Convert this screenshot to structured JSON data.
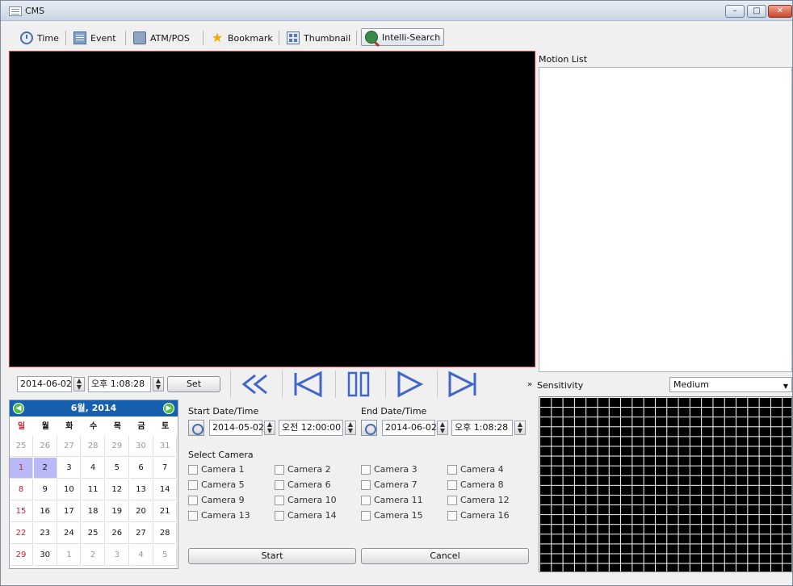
{
  "window": {
    "title": "CMS",
    "minimize": "–",
    "maximize": "□",
    "close": "✕"
  },
  "toolbar": {
    "items": [
      {
        "label": "Time",
        "icon": "clock-icon"
      },
      {
        "label": "Event",
        "icon": "event-icon"
      },
      {
        "label": "ATM/POS",
        "icon": "atm-pos-icon"
      },
      {
        "label": "Bookmark",
        "icon": "bookmark-star-icon"
      },
      {
        "label": "Thumbnail",
        "icon": "thumbnail-icon"
      },
      {
        "label": "Intelli-Search",
        "icon": "intelli-search-icon"
      }
    ]
  },
  "motion": {
    "label": "Motion List"
  },
  "playback": {
    "date": "2014-06-02",
    "time": "오후 1:08:28",
    "set": "Set",
    "more": "»"
  },
  "sensitivity": {
    "label": "Sensitivity",
    "value": "Medium"
  },
  "calendar": {
    "month_label": "6월, 2014",
    "weekdays": [
      "일",
      "월",
      "화",
      "수",
      "목",
      "금",
      "토"
    ],
    "weeks": [
      [
        "25",
        "26",
        "27",
        "28",
        "29",
        "30",
        "31"
      ],
      [
        "1",
        "2",
        "3",
        "4",
        "5",
        "6",
        "7"
      ],
      [
        "8",
        "9",
        "10",
        "11",
        "12",
        "13",
        "14"
      ],
      [
        "15",
        "16",
        "17",
        "18",
        "19",
        "20",
        "21"
      ],
      [
        "22",
        "23",
        "24",
        "25",
        "26",
        "27",
        "28"
      ],
      [
        "29",
        "30",
        "1",
        "2",
        "3",
        "4",
        "5"
      ]
    ]
  },
  "search": {
    "start_label": "Start Date/Time",
    "start_date": "2014-05-02",
    "start_time": "오전 12:00:00",
    "end_label": "End Date/Time",
    "end_date": "2014-06-02",
    "end_time": "오후 1:08:28",
    "select_camera_label": "Select Camera",
    "cameras": [
      "Camera 1",
      "Camera 2",
      "Camera 3",
      "Camera 4",
      "Camera 5",
      "Camera 6",
      "Camera 7",
      "Camera 8",
      "Camera 9",
      "Camera 10",
      "Camera 11",
      "Camera 12",
      "Camera 13",
      "Camera 14",
      "Camera 15",
      "Camera 16"
    ],
    "start_button": "Start",
    "cancel_button": "Cancel"
  }
}
